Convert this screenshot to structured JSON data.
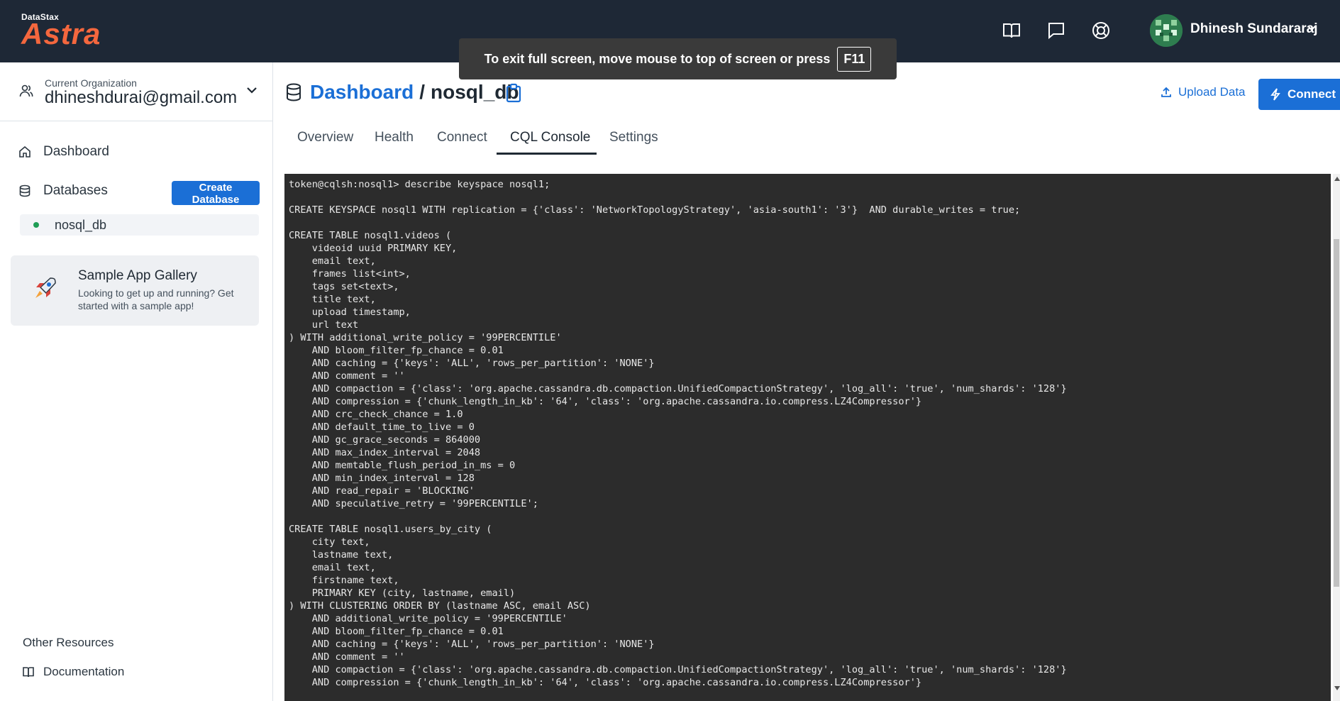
{
  "brand": {
    "small": "DataStax",
    "big": "Astra"
  },
  "topbar": {
    "icons": [
      "book-icon",
      "chat-icon",
      "help-lifebuoy-icon"
    ],
    "user_name": "Dhinesh Sundararaj"
  },
  "toast": {
    "message": "To exit full screen, move mouse to top of screen or press",
    "key": "F11"
  },
  "sidebar": {
    "org_label": "Current Organization",
    "org_value": "dhineshdurai@gmail.com",
    "nav": {
      "dashboard": "Dashboard",
      "databases": "Databases"
    },
    "create_db_label": "Create Database",
    "db_item": "nosql_db",
    "gallery": {
      "title": "Sample App Gallery",
      "desc": "Looking to get up and running? Get started with a sample app!"
    },
    "other_resources": "Other Resources",
    "documentation": "Documentation"
  },
  "header": {
    "crumb_link": "Dashboard",
    "crumb_sep": "/",
    "crumb_current": "nosql_db",
    "upload_label": "Upload Data",
    "connect_label": "Connect"
  },
  "tabs": [
    {
      "label": "Overview",
      "active": false
    },
    {
      "label": "Health",
      "active": false
    },
    {
      "label": "Connect",
      "active": false
    },
    {
      "label": "CQL Console",
      "active": true
    },
    {
      "label": "Settings",
      "active": false
    }
  ],
  "console": {
    "lines": [
      "token@cqlsh:nosql1> describe keyspace nosql1;",
      "",
      "CREATE KEYSPACE nosql1 WITH replication = {'class': 'NetworkTopologyStrategy', 'asia-south1': '3'}  AND durable_writes = true;",
      "",
      "CREATE TABLE nosql1.videos (",
      "    videoid uuid PRIMARY KEY,",
      "    email text,",
      "    frames list<int>,",
      "    tags set<text>,",
      "    title text,",
      "    upload timestamp,",
      "    url text",
      ") WITH additional_write_policy = '99PERCENTILE'",
      "    AND bloom_filter_fp_chance = 0.01",
      "    AND caching = {'keys': 'ALL', 'rows_per_partition': 'NONE'}",
      "    AND comment = ''",
      "    AND compaction = {'class': 'org.apache.cassandra.db.compaction.UnifiedCompactionStrategy', 'log_all': 'true', 'num_shards': '128'}",
      "    AND compression = {'chunk_length_in_kb': '64', 'class': 'org.apache.cassandra.io.compress.LZ4Compressor'}",
      "    AND crc_check_chance = 1.0",
      "    AND default_time_to_live = 0",
      "    AND gc_grace_seconds = 864000",
      "    AND max_index_interval = 2048",
      "    AND memtable_flush_period_in_ms = 0",
      "    AND min_index_interval = 128",
      "    AND read_repair = 'BLOCKING'",
      "    AND speculative_retry = '99PERCENTILE';",
      "",
      "CREATE TABLE nosql1.users_by_city (",
      "    city text,",
      "    lastname text,",
      "    email text,",
      "    firstname text,",
      "    PRIMARY KEY (city, lastname, email)",
      ") WITH CLUSTERING ORDER BY (lastname ASC, email ASC)",
      "    AND additional_write_policy = '99PERCENTILE'",
      "    AND bloom_filter_fp_chance = 0.01",
      "    AND caching = {'keys': 'ALL', 'rows_per_partition': 'NONE'}",
      "    AND comment = ''",
      "    AND compaction = {'class': 'org.apache.cassandra.db.compaction.UnifiedCompactionStrategy', 'log_all': 'true', 'num_shards': '128'}",
      "    AND compression = {'chunk_length_in_kb': '64', 'class': 'org.apache.cassandra.io.compress.LZ4Compressor'}"
    ]
  },
  "colors": {
    "topbar": "#1e2836",
    "brand": "#f4673e",
    "accent": "#1b6fd6",
    "console_bg": "#2c2c2c",
    "status_green": "#1f9d55"
  }
}
